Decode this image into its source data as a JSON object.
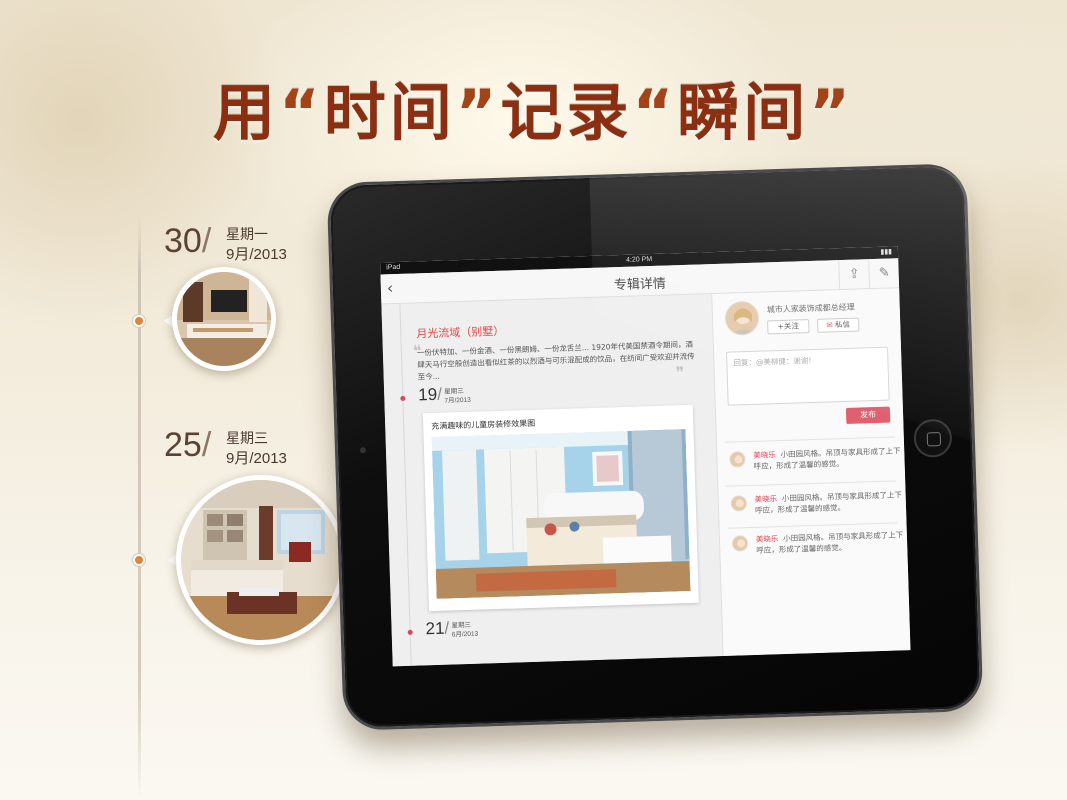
{
  "headline": {
    "p1": "用",
    "q1": "“",
    "w1": "时间",
    "q2": "”",
    "p2": "记录",
    "q3": "“",
    "w2": "瞬间",
    "q4": "”"
  },
  "timeline": [
    {
      "day": "30",
      "weekday": "星期一",
      "month_year": "9月/2013"
    },
    {
      "day": "25",
      "weekday": "星期三",
      "month_year": "9月/2013"
    }
  ],
  "device": {
    "status": {
      "carrier": "iPad",
      "time": "4:20 PM"
    },
    "nav": {
      "back": "‹",
      "title": "专辑详情",
      "share_icon": "share-icon",
      "edit_icon": "edit-icon"
    },
    "album": {
      "title": "月光流域（别墅）",
      "desc": "一份伏特加、一份金酒、一份黑朗姆、一份龙舌兰... 1920年代美国禁酒令期间，酒肆天马行空般创造出看似红茶的以烈酒与可乐混配成的饮品，在纺间广受欢迎并流传至今..."
    },
    "entries": [
      {
        "day": "19",
        "weekday": "星期三",
        "month_year": "7月/2013",
        "card_title": "充满趣味的儿童房装修效果图"
      },
      {
        "day": "21",
        "weekday": "星期三",
        "month_year": "6月/2013"
      }
    ],
    "profile": {
      "role": "城市人家装饰成都总经理",
      "follow": "+关注",
      "message": "私信"
    },
    "reply": {
      "placeholder": "回复：@美柳健：谢谢!",
      "publish": "发布"
    },
    "comments": [
      {
        "name": "美晓乐",
        "text": "小田园风格。吊顶与家具形成了上下呼应，形成了温馨的感觉。"
      },
      {
        "name": "美晓乐",
        "text": "小田园风格。吊顶与家具形成了上下呼应，形成了温馨的感觉。"
      },
      {
        "name": "美晓乐",
        "text": "小田园风格。吊顶与家具形成了上下呼应，形成了温馨的感觉。"
      }
    ]
  },
  "colors": {
    "headline": "#8a2f12",
    "accent": "#e0445a",
    "timeline_dot": "#e1833a"
  }
}
